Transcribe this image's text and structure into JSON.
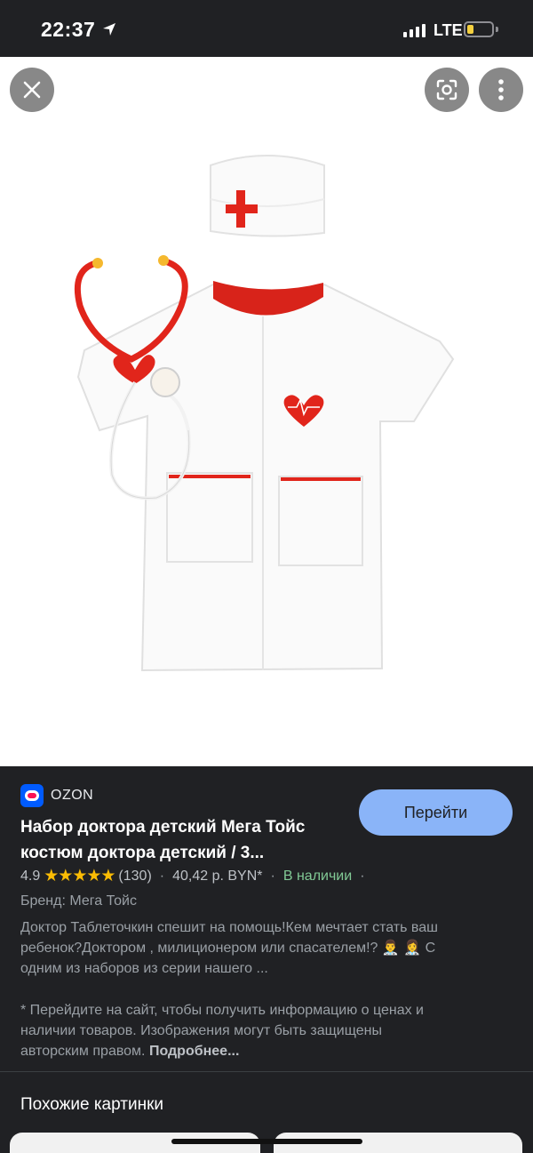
{
  "status_bar": {
    "time": "22:37",
    "network": "LTE"
  },
  "toolbar": {
    "close_icon": "close-icon",
    "lens_icon": "lens-search-icon",
    "more_icon": "more-vert-icon"
  },
  "result": {
    "source": "OZON",
    "button_label": "Перейти",
    "title_line1": "Набор доктора детский Мега Тойс",
    "title_line2": "костюм доктора детский / 3...",
    "rating": "4.9",
    "stars": "★★★★★",
    "reviews": "(130)",
    "price": "40,42 р. BYN*",
    "availability": "В наличии",
    "brand": "Бренд: Мега Тойс",
    "description_line1": "Доктор Таблеточкин спешит на помощь!Кем мечтает стать ваш",
    "description_line2": "ребенок?Доктором , милиционером или спасателем!? 👨‍⚕️ 👩‍⚕️ С",
    "description_line3": "одним из наборов из серии нашего ...",
    "disclaimer_line1": "* Перейдите на сайт, чтобы получить информацию о ценах и",
    "disclaimer_line2": "наличии товаров. Изображения могут быть защищены",
    "disclaimer_line3": "авторским правом.",
    "more_link": "Подробнее..."
  },
  "similar": {
    "title": "Похожие картинки"
  },
  "colors": {
    "accent": "#8ab4f8",
    "stock": "#81c995",
    "star": "#fbbc04",
    "brand": "#005bff"
  }
}
